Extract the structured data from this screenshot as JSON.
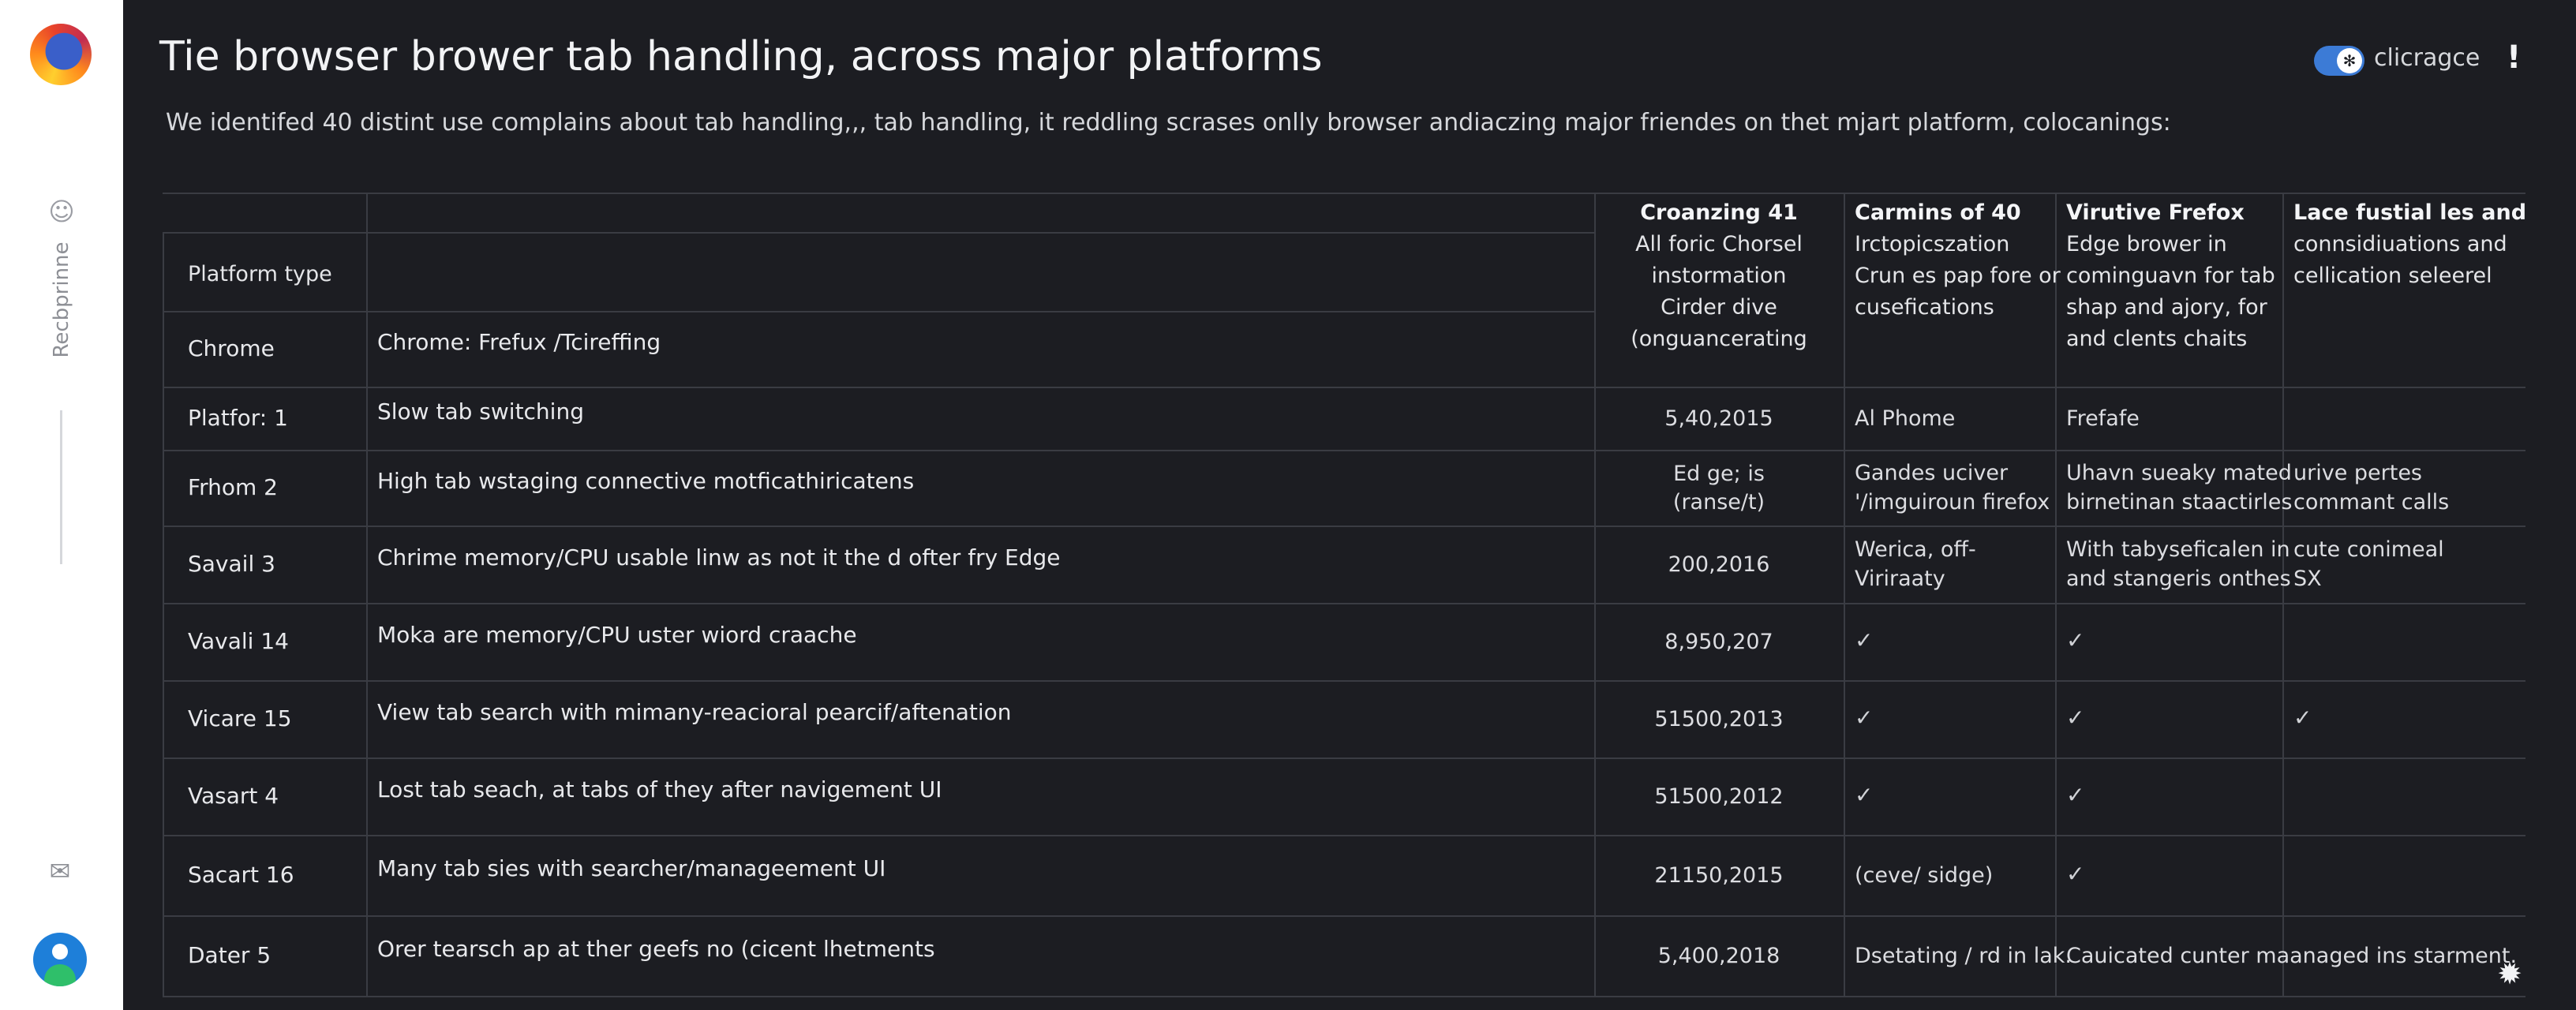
{
  "window": {
    "title": "Tie browser brower tab handling, across major platforms",
    "subtitle": "We identifed 40 distint use complains  about tab handling,,, tab handling, it reddling scrases onlly browser andiaczing major friendes on thet mjart platform, colocanings:",
    "toggle_label": "clicragce",
    "menu_glyph": "!"
  },
  "sidebar": {
    "vertical_label": "Recbprinne"
  },
  "table": {
    "col0_header": "Platform type",
    "col1_header": "",
    "col2_header": [
      "Croanzing 41",
      "All foric Chorsel",
      "instormation",
      "Cirder dive",
      "(onguancerating"
    ],
    "col3_header": [
      "Carmins of 40",
      "Irctopicszation",
      "Crun es pap fore or",
      "cusefications"
    ],
    "col4_header": [
      "Virutive Frefox",
      "Edge brower in",
      "cominguavn for tab",
      "shap and ajory, for",
      "and clents chaits"
    ],
    "col5_header": [
      "Lace fustial les and",
      "connsidiuations and",
      "cellication seleerel"
    ],
    "rows": [
      {
        "platform": "Chrome",
        "issue": "Chrome: Frefux /Tcireffing",
        "count": "",
        "c3": [],
        "c4": [],
        "c5": []
      },
      {
        "platform": "Platfor: 1",
        "issue": "Slow tab switching",
        "count": "5,40,2015",
        "c3": [
          "Al Phome"
        ],
        "c4": [
          "Frefafe"
        ],
        "c5": []
      },
      {
        "platform": "Frhom 2",
        "issue": "High tab wstaging connective motficathiricatens",
        "count": "Ed ge;  is\n(ranse/t)",
        "c3": [
          "Gandes uciver",
          "'/imguiroun firefox"
        ],
        "c4": [
          "Uhavn sueaky mated",
          "birnetinan staactirles"
        ],
        "c5": [
          "urive pertes",
          "commant calls"
        ]
      },
      {
        "platform": "Savail 3",
        "issue": "Chrime memory/CPU usable linw as not it the d ofter fry Edge",
        "count": "200,2016",
        "c3": [
          "Werica, off-",
          "Viriraaty"
        ],
        "c4": [
          "With tabyseficalen in",
          "and stangeris onthes"
        ],
        "c5": [
          "cute conimeal",
          "SX"
        ]
      },
      {
        "platform": "Vavali 14",
        "issue": "Moka are memory/CPU uster wiord craache",
        "count": "8,950,207",
        "c3": [
          "✓"
        ],
        "c4": [
          "✓"
        ],
        "c5": []
      },
      {
        "platform": "Vicare 15",
        "issue": "View tab search with mimany-reacioral pearcif/aftenation",
        "count": "51500,2013",
        "c3": [
          "✓"
        ],
        "c4": [
          "✓"
        ],
        "c5": [
          "✓"
        ]
      },
      {
        "platform": "Vasart 4",
        "issue": "Lost tab seach, at tabs of they after navigement UI",
        "count": "51500,2012",
        "c3": [
          "✓"
        ],
        "c4": [
          "✓"
        ],
        "c5": []
      },
      {
        "platform": "Sacart 16",
        "issue": "Many tab sies with searcher/manageement UI",
        "count": "21150,2015",
        "c3": [
          "(ceve/ sidge)"
        ],
        "c4": [
          "✓"
        ],
        "c5": []
      },
      {
        "platform": "Dater 5",
        "issue": "Orer tearsch ap at ther geefs no (cicent lhetments",
        "count": "5,400,2018",
        "c3": [
          "Dsetating / rd in lak."
        ],
        "c4": [
          "Cauicated cunter maanaged ins starment."
        ],
        "c5": []
      }
    ]
  },
  "icons": {
    "logo": "browser-logo-icon",
    "robot": "robot-icon",
    "mail": "mail-icon",
    "avatar": "user-avatar-icon",
    "toggle": "toggle-switch-icon",
    "kebab": "menu-icon",
    "corner": "settings-gear-icon"
  },
  "colors": {
    "panel_bg": "#1c1d22",
    "sidebar_bg": "#ffffff",
    "accent": "#3c7bd6",
    "grid": "#3a3c43"
  }
}
